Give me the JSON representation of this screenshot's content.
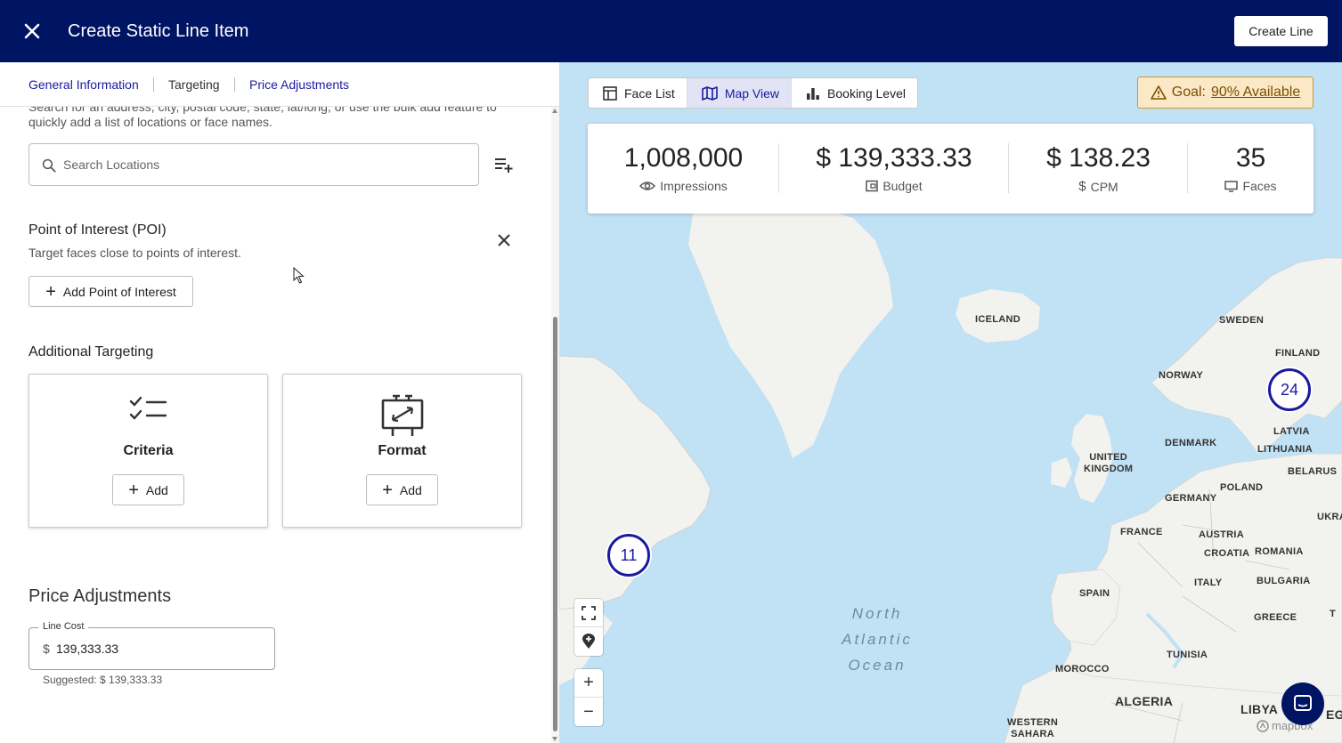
{
  "header": {
    "title": "Create Static Line Item",
    "create_button": "Create Line"
  },
  "tabs": [
    {
      "label": "General Information"
    },
    {
      "label": "Targeting"
    },
    {
      "label": "Price Adjustments"
    }
  ],
  "location": {
    "help_text": "Search for an address, city, postal code, state, lat/long, or use the bulk add feature to quickly add a list of locations or face names.",
    "search_placeholder": "Search Locations"
  },
  "poi": {
    "title": "Point of Interest (POI)",
    "subtitle": "Target faces close to points of interest.",
    "add_button": "Add Point of Interest"
  },
  "additional_targeting": {
    "title": "Additional Targeting",
    "cards": [
      {
        "title": "Criteria",
        "icon": "checklist-icon",
        "button": "Add"
      },
      {
        "title": "Format",
        "icon": "billboard-icon",
        "button": "Add"
      }
    ]
  },
  "price": {
    "title": "Price Adjustments",
    "field_label": "Line Cost",
    "currency": "$",
    "value": "139,333.33",
    "suggested": "Suggested: $ 139,333.33"
  },
  "map": {
    "views": [
      {
        "label": "Face List",
        "icon": "table-icon",
        "active": false
      },
      {
        "label": "Map View",
        "icon": "map-icon",
        "active": true
      },
      {
        "label": "Booking Level",
        "icon": "bar-chart-icon",
        "active": false
      }
    ],
    "goal": {
      "prefix": "Goal:",
      "value": "90% Available",
      "color": "#fbe8c6"
    },
    "stats": [
      {
        "value": "1,008,000",
        "label": "Impressions",
        "icon": "eye-icon"
      },
      {
        "value": "$ 139,333.33",
        "label": "Budget",
        "icon": "wallet-icon"
      },
      {
        "value": "$ 138.23",
        "label": "CPM",
        "icon": "dollar-icon"
      },
      {
        "value": "35",
        "label": "Faces",
        "icon": "monitor-icon"
      }
    ],
    "clusters": [
      {
        "count": "11"
      },
      {
        "count": "24"
      }
    ],
    "labels": {
      "iceland": "ICELAND",
      "sweden": "SWEDEN",
      "finland": "FINLAND",
      "norway": "NORWAY",
      "latvia": "LATVIA",
      "denmark": "DENMARK",
      "lithuania": "LITHUANIA",
      "uk_line1": "UNITED",
      "uk_line2": "KINGDOM",
      "belarus": "BELARUS",
      "poland": "POLAND",
      "germany": "GERMANY",
      "ukraine": "UKRAI",
      "france": "FRANCE",
      "austria": "AUSTRIA",
      "croatia": "CROATIA",
      "romania": "ROMANIA",
      "italy": "ITALY",
      "bulgaria": "BULGARIA",
      "spain": "SPAIN",
      "greece": "GREECE",
      "tunisia": "TUNISIA",
      "morocco": "MOROCCO",
      "algeria": "ALGERIA",
      "libya": "LIBYA",
      "egypt": "EGYPT",
      "turkey": "T",
      "ws_line1": "WESTERN",
      "ws_line2": "SAHARA",
      "ocean_line1": "North",
      "ocean_line2": "Atlantic",
      "ocean_line3": "Ocean"
    },
    "attribution": "mapbox",
    "land_color": "#f2f2ef",
    "water_color": "#c1e1f4"
  }
}
